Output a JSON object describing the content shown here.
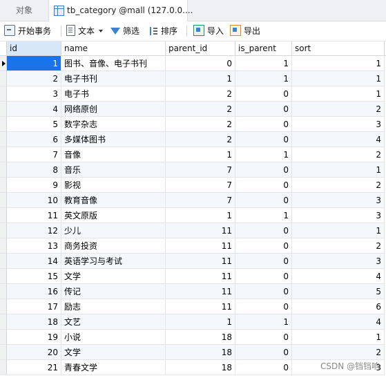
{
  "tabs": {
    "objects": "对象",
    "table": "tb_category @mall (127.0.0...."
  },
  "toolbar": {
    "begin_transaction": "开始事务",
    "text": "文本",
    "filter": "筛选",
    "sort": "排序",
    "import": "导入",
    "export": "导出"
  },
  "columns": [
    "id",
    "name",
    "parent_id",
    "is_parent",
    "sort"
  ],
  "rows": [
    {
      "id": "1",
      "name": "图书、音像、电子书刊",
      "parent_id": "0",
      "is_parent": "1",
      "sort": "1"
    },
    {
      "id": "2",
      "name": "电子书刊",
      "parent_id": "1",
      "is_parent": "1",
      "sort": "1"
    },
    {
      "id": "3",
      "name": "电子书",
      "parent_id": "2",
      "is_parent": "0",
      "sort": "1"
    },
    {
      "id": "4",
      "name": "网络原创",
      "parent_id": "2",
      "is_parent": "0",
      "sort": "2"
    },
    {
      "id": "5",
      "name": "数字杂志",
      "parent_id": "2",
      "is_parent": "0",
      "sort": "3"
    },
    {
      "id": "6",
      "name": "多媒体图书",
      "parent_id": "2",
      "is_parent": "0",
      "sort": "4"
    },
    {
      "id": "7",
      "name": "音像",
      "parent_id": "1",
      "is_parent": "1",
      "sort": "2"
    },
    {
      "id": "8",
      "name": "音乐",
      "parent_id": "7",
      "is_parent": "0",
      "sort": "1"
    },
    {
      "id": "9",
      "name": "影视",
      "parent_id": "7",
      "is_parent": "0",
      "sort": "2"
    },
    {
      "id": "10",
      "name": "教育音像",
      "parent_id": "7",
      "is_parent": "0",
      "sort": "3"
    },
    {
      "id": "11",
      "name": "英文原版",
      "parent_id": "1",
      "is_parent": "1",
      "sort": "3"
    },
    {
      "id": "12",
      "name": "少儿",
      "parent_id": "11",
      "is_parent": "0",
      "sort": "1"
    },
    {
      "id": "13",
      "name": "商务投资",
      "parent_id": "11",
      "is_parent": "0",
      "sort": "2"
    },
    {
      "id": "14",
      "name": "英语学习与考试",
      "parent_id": "11",
      "is_parent": "0",
      "sort": "3"
    },
    {
      "id": "15",
      "name": "文学",
      "parent_id": "11",
      "is_parent": "0",
      "sort": "4"
    },
    {
      "id": "16",
      "name": "传记",
      "parent_id": "11",
      "is_parent": "0",
      "sort": "5"
    },
    {
      "id": "17",
      "name": "励志",
      "parent_id": "11",
      "is_parent": "0",
      "sort": "6"
    },
    {
      "id": "18",
      "name": "文艺",
      "parent_id": "1",
      "is_parent": "1",
      "sort": "4"
    },
    {
      "id": "19",
      "name": "小说",
      "parent_id": "18",
      "is_parent": "0",
      "sort": "1"
    },
    {
      "id": "20",
      "name": "文学",
      "parent_id": "18",
      "is_parent": "0",
      "sort": "2"
    },
    {
      "id": "21",
      "name": "青春文学",
      "parent_id": "18",
      "is_parent": "0",
      "sort": "3"
    }
  ],
  "watermark": "CSDN @铛铛响",
  "colors": {
    "selected_cell": "#1a73e8",
    "alt_row": "#f4f8fc",
    "selected_header": "#d7e7f7"
  }
}
